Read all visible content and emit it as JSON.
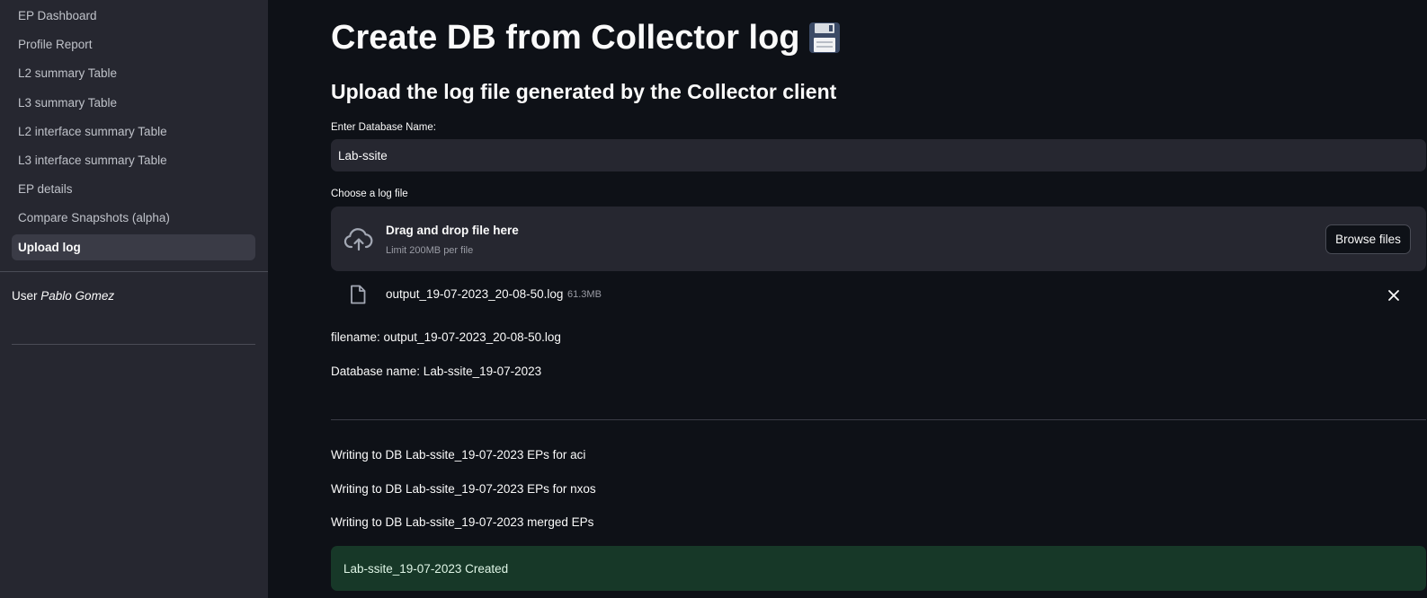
{
  "sidebar": {
    "items": [
      {
        "label": "EP Dashboard"
      },
      {
        "label": "Profile Report"
      },
      {
        "label": "L2 summary Table"
      },
      {
        "label": "L3 summary Table"
      },
      {
        "label": "L2 interface summary Table"
      },
      {
        "label": "L3 interface summary Table"
      },
      {
        "label": "EP details"
      },
      {
        "label": "Compare Snapshots (alpha)"
      },
      {
        "label": "Upload log",
        "active": true
      }
    ],
    "user_prefix": "User",
    "user_name": "Pablo Gomez"
  },
  "main": {
    "title": "Create DB from Collector log",
    "title_icon": "floppy-disk-icon",
    "subtitle": "Upload the log file generated by the Collector client",
    "db_name_label": "Enter Database Name:",
    "db_name_value": "Lab-ssite",
    "file_label": "Choose a log file",
    "dropzone": {
      "icon": "cloud-upload-icon",
      "title": "Drag and drop file here",
      "limit": "Limit 200MB per file",
      "browse_label": "Browse files"
    },
    "uploaded_file": {
      "icon": "file-icon",
      "name": "output_19-07-2023_20-08-50.log",
      "size": "61.3MB"
    },
    "filename_line": "filename: output_19-07-2023_20-08-50.log",
    "dbname_line": "Database name: Lab-ssite_19-07-2023",
    "log_lines": [
      "Writing to DB Lab-ssite_19-07-2023 EPs for aci",
      "Writing to DB Lab-ssite_19-07-2023 EPs for nxos",
      "Writing to DB Lab-ssite_19-07-2023 merged EPs"
    ],
    "success_message": "Lab-ssite_19-07-2023 Created"
  },
  "colors": {
    "background": "#0e1117",
    "sidebar": "#262730",
    "success_bg": "#173828"
  }
}
